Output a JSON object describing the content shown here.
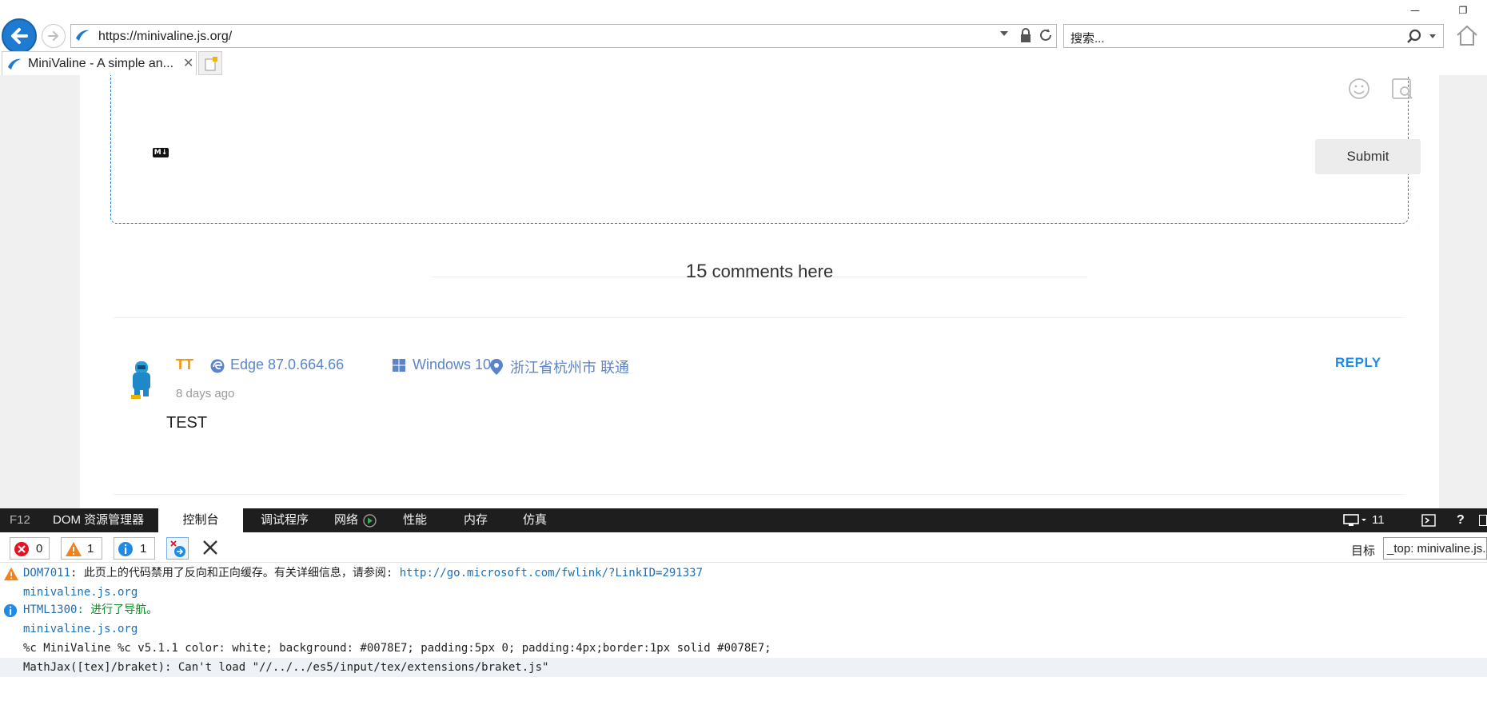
{
  "browser": {
    "address": "https://minivaline.js.org/",
    "search_placeholder": "搜索...",
    "tab_title": "MiniValine - A simple an...",
    "tab_close": "✕",
    "window_controls": [
      "minimize-icon",
      "restore-icon"
    ]
  },
  "editor": {
    "markdown_badge": "M↓",
    "submit_label": "Submit",
    "icons": [
      "emoji-icon",
      "preview-icon"
    ]
  },
  "comments": {
    "count": "15",
    "count_suffix": " comments here",
    "items": [
      {
        "author": "TT",
        "browser": "Edge 87.0.664.66",
        "os": "Windows 10",
        "location": "浙江省杭州市 联通",
        "time": "8 days ago",
        "text": "TEST",
        "reply_label": "REPLY"
      }
    ]
  },
  "devtools": {
    "tabs": [
      "F12",
      "DOM 资源管理器",
      "控制台",
      "调试程序",
      "网络",
      "性能",
      "内存",
      "仿真"
    ],
    "active_tab": "控制台",
    "emulation_version": "11",
    "help_label": "?",
    "counters": {
      "errors": "0",
      "warnings": "1",
      "info": "1"
    },
    "target_label": "目标",
    "target_value": "_top: minivaline.js.org",
    "log": [
      {
        "level": "warning",
        "code": "DOM7011",
        "message": ": 此页上的代码禁用了反向和正向缓存。有关详细信息，请参阅: ",
        "link": "http://go.microsoft.com/fwlink/?LinkID=291337",
        "source": "minivaline.js.org"
      },
      {
        "level": "info",
        "code": "HTML1300",
        "message": ": 进行了导航。",
        "source": "minivaline.js.org"
      },
      {
        "level": "log",
        "message": "%c MiniValine %c v5.1.1  color: white; background: #0078E7; padding:5px 0; padding:4px;border:1px solid #0078E7;"
      },
      {
        "level": "log",
        "message": "MathJax([tex]/braket): Can't load \"//../../es5/input/tex/extensions/braket.js\""
      }
    ]
  },
  "colors": {
    "accent": "#1f7bd1",
    "author": "#f6950a",
    "meta": "#5c85c9",
    "reply": "#1e8be6",
    "devtools_bar": "#1e1e1e"
  }
}
